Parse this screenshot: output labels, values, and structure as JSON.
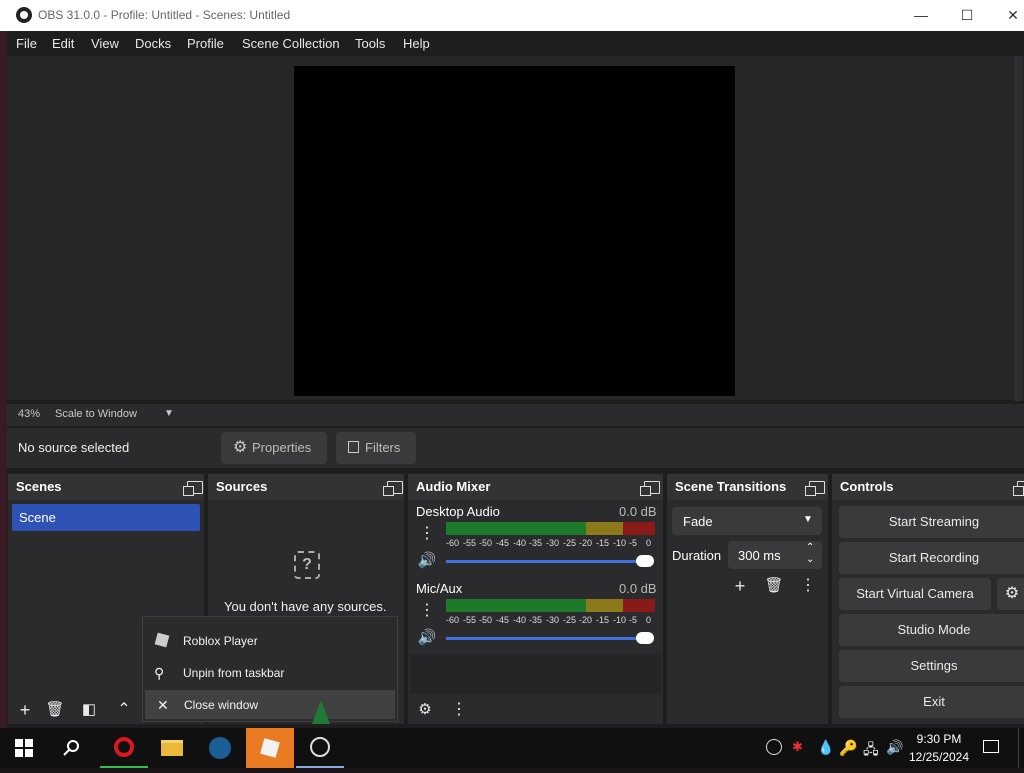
{
  "window": {
    "title": "OBS 31.0.0 - Profile: Untitled - Scenes: Untitled",
    "minimize_glyph": "—",
    "maximize_glyph": "☐",
    "close_glyph": "✕"
  },
  "menu": [
    "File",
    "Edit",
    "View",
    "Docks",
    "Profile",
    "Scene Collection",
    "Tools",
    "Help"
  ],
  "preview": {
    "zoom": "43%",
    "scale_mode": "Scale to Window"
  },
  "source_bar": {
    "status": "No source selected",
    "properties_label": "Properties",
    "filters_label": "Filters"
  },
  "scenes": {
    "title": "Scenes",
    "items": [
      "Scene"
    ]
  },
  "sources": {
    "title": "Sources",
    "empty_text": "You don't have any sources."
  },
  "audio_mixer": {
    "title": "Audio Mixer",
    "channels": [
      {
        "name": "Desktop Audio",
        "level": "0.0 dB",
        "volume_fraction": 1.0
      },
      {
        "name": "Mic/Aux",
        "level": "0.0 dB",
        "volume_fraction": 1.0
      }
    ],
    "scale_labels": [
      "-60",
      "-55",
      "-50",
      "-45",
      "-40",
      "-35",
      "-30",
      "-25",
      "-20",
      "-15",
      "-10",
      "-5",
      "0"
    ]
  },
  "transitions": {
    "title": "Scene Transitions",
    "selected": "Fade",
    "duration_label": "Duration",
    "duration_value": "300 ms"
  },
  "controls": {
    "title": "Controls",
    "buttons": [
      "Start Streaming",
      "Start Recording",
      "Start Virtual Camera",
      "Studio Mode",
      "Settings",
      "Exit"
    ]
  },
  "context_menu": {
    "items": [
      "Roblox Player",
      "Unpin from taskbar",
      "Close window"
    ]
  },
  "taskbar": {
    "time": "9:30 PM",
    "date": "12/25/2024",
    "apps": [
      "start-icon",
      "search-icon",
      "opera-icon",
      "file-explorer-icon",
      "steam-icon",
      "roblox-icon",
      "obs-icon"
    ]
  },
  "colors": {
    "scene_selected": "#2f52b6",
    "meter_green": "#1c7a2a",
    "meter_yellow": "#8a7a1a",
    "meter_red": "#8a1a1a",
    "volume_slider": "#3f6ee0",
    "roblox_highlight": "#e87a22"
  }
}
